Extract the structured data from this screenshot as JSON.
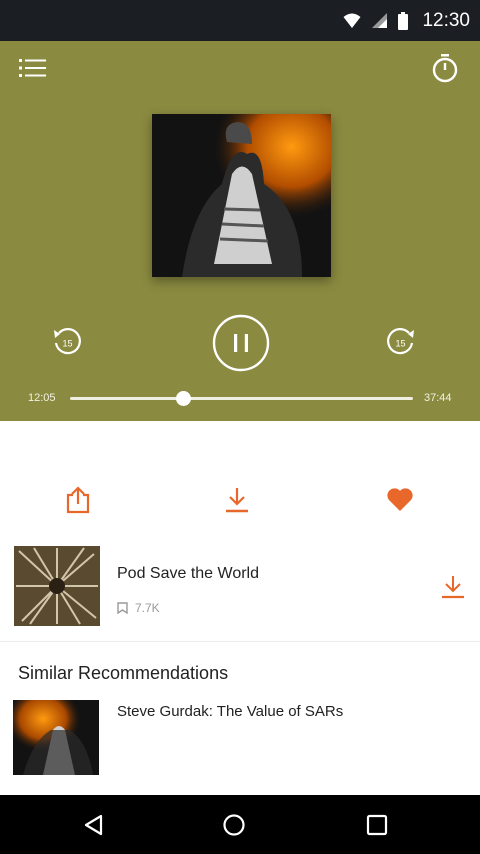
{
  "status_bar": {
    "time": "12:30"
  },
  "player": {
    "background_color": "#8a8a40",
    "elapsed": "12:05",
    "duration": "37:44",
    "progress": 0.33,
    "skip_back_seconds": "15",
    "skip_forward_seconds": "15",
    "icons": {
      "menu": "list-icon",
      "timer": "stopwatch-icon",
      "rewind": "rewind-15-icon",
      "pause": "pause-icon",
      "forward": "forward-15-icon"
    }
  },
  "actions": {
    "accent_color": "#e8682c",
    "items": [
      "share-icon",
      "download-icon",
      "heart-icon"
    ]
  },
  "podcast": {
    "title": "Pod Save the World",
    "listens": "7.7K"
  },
  "recommendations": {
    "title": "Similar Recommendations",
    "items": [
      {
        "title": "Steve Gurdak: The Value of SARs"
      }
    ]
  },
  "nav": [
    "back-icon",
    "home-icon",
    "recents-icon"
  ]
}
